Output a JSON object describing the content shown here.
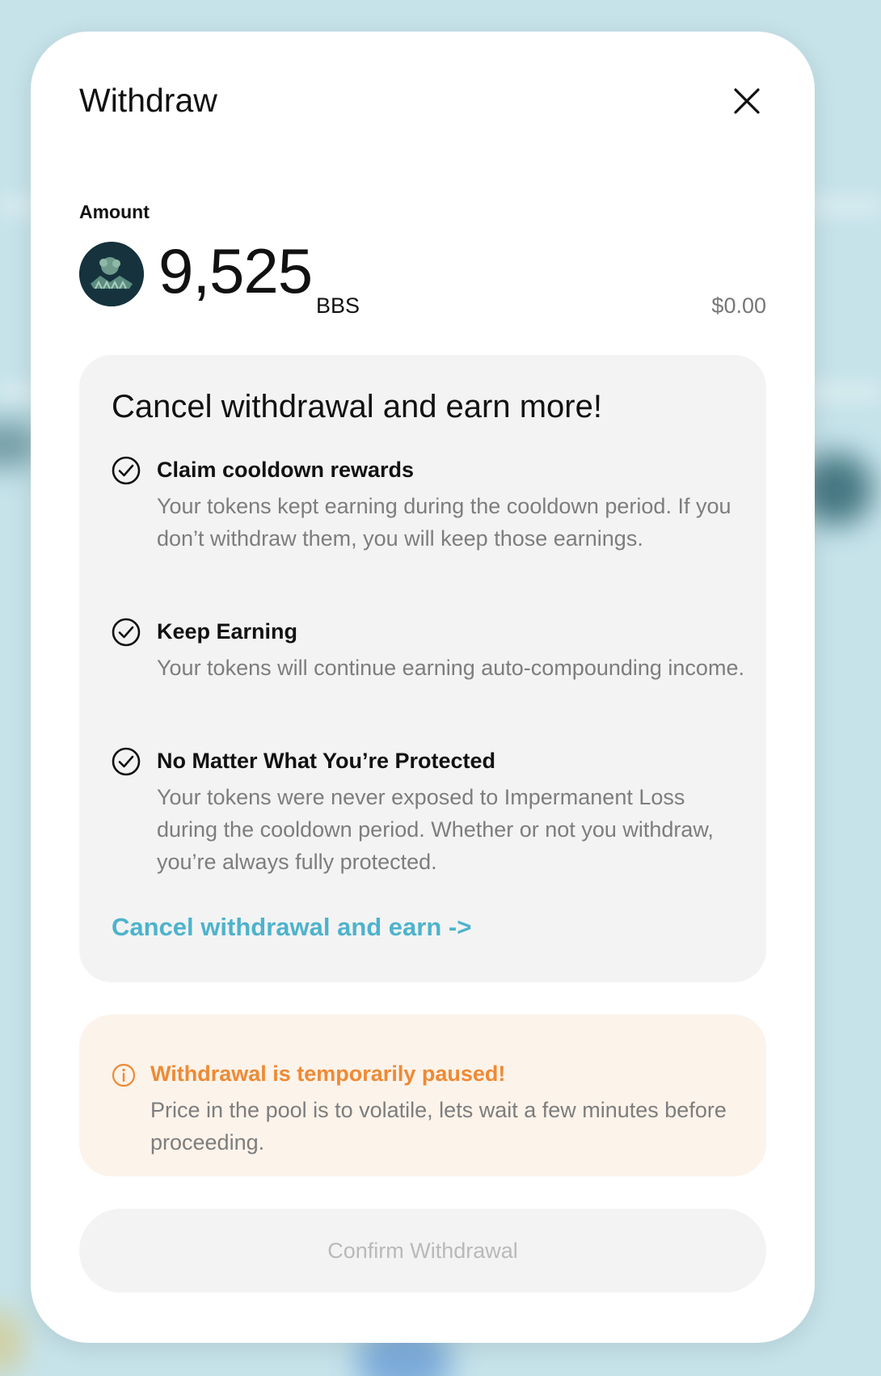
{
  "dialog": {
    "title": "Withdraw",
    "close_icon": "close-icon"
  },
  "amount": {
    "label": "Amount",
    "value": "9,525",
    "symbol": "BBS",
    "usd_value": "$0.00",
    "token_icon": "token-avatar"
  },
  "offer": {
    "title": "Cancel withdrawal and earn more!",
    "benefits": [
      {
        "icon": "check-circle-icon",
        "title": "Claim cooldown rewards",
        "description": "Your tokens kept earning during the cooldown period. If you don’t withdraw them, you will keep those earnings."
      },
      {
        "icon": "check-circle-icon",
        "title": "Keep Earning",
        "description": "Your tokens will continue earning auto-compounding income."
      },
      {
        "icon": "check-circle-icon",
        "title": "No Matter What You’re Protected",
        "description": "Your tokens were never exposed to Impermanent Loss during the cooldown period. Whether or not you withdraw, you’re always fully protected."
      }
    ],
    "cancel_link": "Cancel withdrawal and earn ->"
  },
  "warning": {
    "icon": "info-icon",
    "title": "Withdrawal is temporarily paused!",
    "description": "Price in the pool is to volatile, lets wait a few minutes before proceeding."
  },
  "confirm": {
    "label": "Confirm Withdrawal",
    "disabled": true
  },
  "colors": {
    "accent_link": "#4db3cc",
    "warning_accent": "#ee8a35",
    "warning_background": "#fcf3ea",
    "card_background": "#f3f3f3",
    "backdrop": "#c6e3ea"
  }
}
